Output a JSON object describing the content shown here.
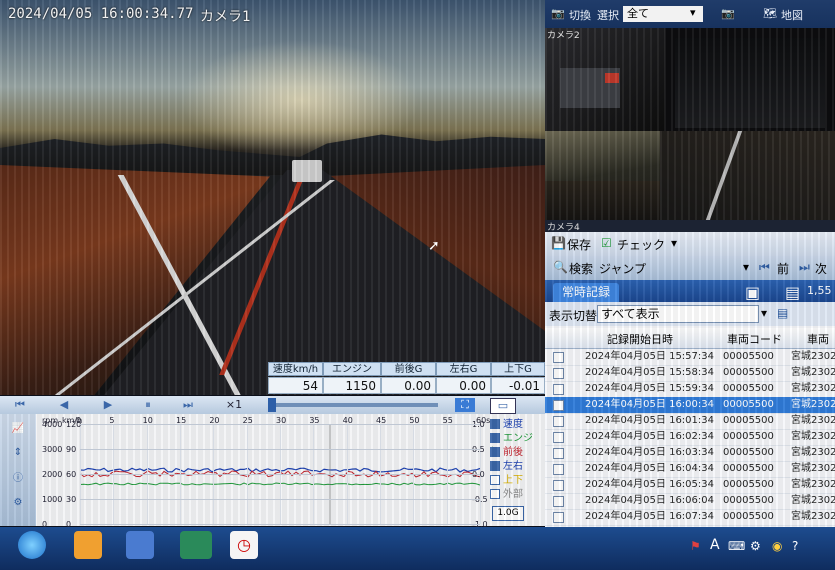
{
  "main_camera": {
    "timestamp": "2024/04/05 16:00:34.77",
    "camera_label": "カメラ1"
  },
  "gauges": [
    {
      "label": "速度km/h",
      "value": "54"
    },
    {
      "label": "エンジンrpm",
      "value": "1150"
    },
    {
      "label": "前後G",
      "value": "0.00"
    },
    {
      "label": "左右G",
      "value": "0.00"
    },
    {
      "label": "上下G",
      "value": "-0.01"
    }
  ],
  "playback": {
    "speed": "×1"
  },
  "graph": {
    "x_ticks": [
      "0",
      "5",
      "10",
      "15",
      "20",
      "25",
      "30",
      "35",
      "40",
      "45",
      "50",
      "55",
      "60s"
    ],
    "rpm_ticks": [
      "4000",
      "3000",
      "2000",
      "1000",
      "0"
    ],
    "kmh_ticks": [
      "120",
      "90",
      "60",
      "30",
      "0"
    ],
    "g_ticks": [
      "1.0",
      "0.5",
      "0.0",
      "-0.5",
      "-1.0"
    ],
    "axis_units_rpm": "rpm",
    "axis_units_kmh": "km/h",
    "legend": [
      {
        "label": "速度",
        "checked": true,
        "color": "#1a3fb0"
      },
      {
        "label": "エンジン",
        "checked": true,
        "color": "#1f9a3a"
      },
      {
        "label": "前後",
        "checked": true,
        "color": "#c0202a"
      },
      {
        "label": "左右",
        "checked": true,
        "color": "#1a3fb0"
      },
      {
        "label": "上下",
        "checked": false,
        "color": "#d8b000"
      },
      {
        "label": "外部",
        "checked": false,
        "color": "#888888"
      }
    ],
    "scale_value": "1.0G"
  },
  "right_toolbar": {
    "switch_label": "切換",
    "select_label": "選択",
    "filter_value": "全て",
    "window_label": "地図"
  },
  "cameras": {
    "cam2": "カメラ2",
    "cam4": "カメラ4"
  },
  "list_panel": {
    "save": "保存",
    "check": "チェック",
    "search": "検索",
    "jump": "ジャンプ",
    "prev": "前",
    "next": "次",
    "tab": "常時記録",
    "count": "1,55",
    "filter_label": "表示切替",
    "filter_value": "すべて表示",
    "columns": [
      "記録開始日時",
      "車両コード",
      "車両"
    ],
    "rows": [
      {
        "datetime": "2024年04月05日 15:57:34",
        "code": "00005500",
        "vehicle": "宮城2302"
      },
      {
        "datetime": "2024年04月05日 15:58:34",
        "code": "00005500",
        "vehicle": "宮城2302"
      },
      {
        "datetime": "2024年04月05日 15:59:34",
        "code": "00005500",
        "vehicle": "宮城2302"
      },
      {
        "datetime": "2024年04月05日 16:00:34",
        "code": "00005500",
        "vehicle": "宮城2302",
        "selected": true
      },
      {
        "datetime": "2024年04月05日 16:01:34",
        "code": "00005500",
        "vehicle": "宮城2302"
      },
      {
        "datetime": "2024年04月05日 16:02:34",
        "code": "00005500",
        "vehicle": "宮城2302"
      },
      {
        "datetime": "2024年04月05日 16:03:34",
        "code": "00005500",
        "vehicle": "宮城2302"
      },
      {
        "datetime": "2024年04月05日 16:04:34",
        "code": "00005500",
        "vehicle": "宮城2302"
      },
      {
        "datetime": "2024年04月05日 16:05:34",
        "code": "00005500",
        "vehicle": "宮城2302"
      },
      {
        "datetime": "2024年04月05日 16:06:04",
        "code": "00005500",
        "vehicle": "宮城2302"
      },
      {
        "datetime": "2024年04月05日 16:07:34",
        "code": "00005500",
        "vehicle": "宮城2302"
      }
    ]
  },
  "taskbar": {
    "ime_label": "A"
  }
}
